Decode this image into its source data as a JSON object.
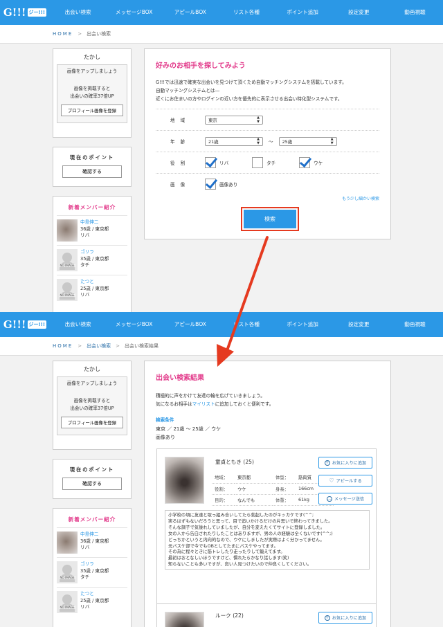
{
  "nav": {
    "logo_text": "G!!!",
    "logo_tag": "ジー!!!",
    "items": [
      "出会い検索",
      "メッセージBOX",
      "アピールBOX",
      "リスト各種",
      "ポイント追加",
      "設定変更",
      "動画視聴"
    ]
  },
  "screen1": {
    "breadcrumb": {
      "home": "HOME",
      "sep": ">",
      "current": "出会い検索"
    }
  },
  "screen2": {
    "breadcrumb": {
      "home": "HOME",
      "sep": ">",
      "parent": "出会い検索",
      "current": "出会い検索結果"
    }
  },
  "sidebar": {
    "username": "たかし",
    "photo_heading": "画像をアップしましょう",
    "photo_msg_1": "画像を掲載すると",
    "photo_msg_2": "出会いの確率37倍UP",
    "photo_button": "プロフィール画像を登録",
    "points_title": "現在のポイント",
    "points_button": "確認する",
    "members_title": "新着メンバー紹介",
    "no_image_label": "NO IMAGE",
    "members": [
      {
        "name": "中島伸二",
        "info": "36歳 / 東京都",
        "role": "リバ"
      },
      {
        "name": "ゴリラ",
        "info": "35歳 / 東京都",
        "role": "タチ"
      },
      {
        "name": "たつと",
        "info": "25歳 / 東京都",
        "role": "リバ"
      }
    ]
  },
  "search": {
    "title": "好みのお相手を探してみよう",
    "desc_1": "G!!!では迅速で確実な出会いを見つけて頂くため自動マッチングシステムを搭載しています。",
    "desc_2": "自動マッチングシステムとは―",
    "desc_3": "近くにお住まいの方やログインの近い方を優先的に表示させる出会い特化型システムです。",
    "region_label": "地域",
    "region_value": "東京",
    "age_label": "年齢",
    "age_from": "21歳",
    "age_sep": "〜",
    "age_to": "25歳",
    "role_label": "役割",
    "roles": [
      "リバ",
      "タチ",
      "ウケ"
    ],
    "image_label": "画像",
    "image_option": "画像あり",
    "detail_link": "もう少し細かい検索",
    "search_button": "検索"
  },
  "results": {
    "title": "出会い検索結果",
    "desc_1": "積極的に声をかけて友達の輪を広げていきましょう。",
    "desc_2a": "気になるお相手は",
    "desc_2_link": "マイリスト",
    "desc_2b": "に追加しておくと便利です。",
    "cond_title": "検索条件",
    "cond_line": "東京 ／ 21歳 〜 25歳 ／ ウケ",
    "cond_image": "画像あり",
    "action_favorite": "お気に入りに追加",
    "action_appeal": "アピールする",
    "action_message": "メッセージ送信",
    "profile": {
      "name": "童貞ともき (25)",
      "k_region": "地域：",
      "v_region": "東京都",
      "k_body": "体型：",
      "v_body": "筋肉質",
      "k_role": "役割：",
      "v_role": "ウケ",
      "k_height": "身長：",
      "v_height": "166cm",
      "k_purpose": "目的：",
      "v_purpose": "なんでも",
      "k_weight": "体重：",
      "v_weight": "61kg",
      "message": [
        "小学校の頃に友達と取っ組み合いしてたら勃起したのがキッカケです(^^;",
        "実るはずもないだろうと思って、目で追いかけるだけの片思いで終わってきました。",
        "そんな調子で気後れしていましたが、自分を変えたくてサイトに登録しました。",
        "女の人から告白されたりしたことはありますが、男の人の経験は全くないです(^^;)",
        "どっちかというと内向的なので、ウケにしましたが実際はよく分かってません。",
        "元バスケ部で今でもOBとしてたまにバスケやってます。",
        "その為に程々ときに筋トレしたり走ったりして鍛えてます。",
        "最初はおとなしいほうですけど、慣れたらかなり話します(笑)",
        "知らないことも多いですが、良い人見つけたいので仲良くしてください。"
      ]
    },
    "profile2_name": "ルーク (22)"
  },
  "colors": {
    "nav": "#2b98e6",
    "pink": "#e2398a",
    "highlight": "#e53a20"
  }
}
